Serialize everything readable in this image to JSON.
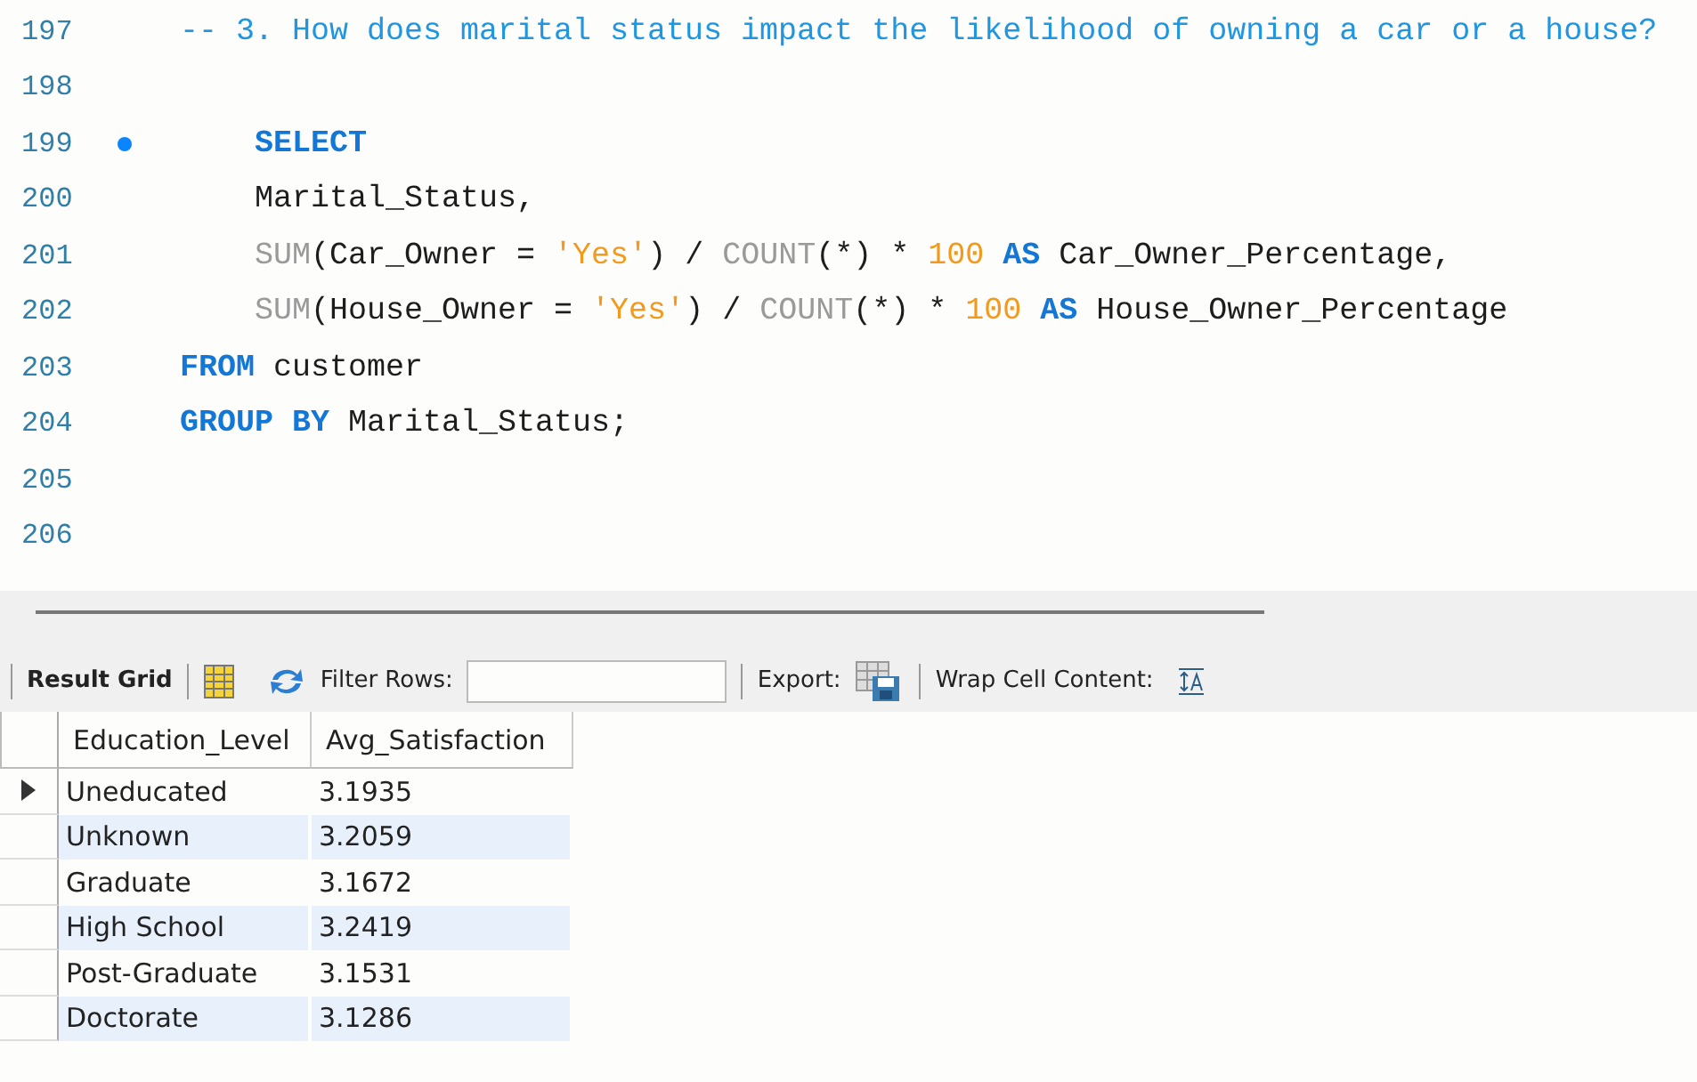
{
  "editor": {
    "lines": [
      {
        "number": "197",
        "breakpoint": false,
        "tokens": [
          {
            "kind": "comment",
            "text": "-- 3. How does marital status impact the likelihood of owning a car or a house?"
          }
        ]
      },
      {
        "number": "198",
        "breakpoint": false
      },
      {
        "number": "199",
        "breakpoint": true,
        "tokens": [
          {
            "kind": "keyword",
            "text": "    SELECT"
          }
        ]
      },
      {
        "number": "200",
        "breakpoint": false,
        "tokens": [
          {
            "kind": "plain",
            "text": "    Marital_Status,"
          }
        ]
      },
      {
        "number": "201",
        "breakpoint": false,
        "tokens": [
          {
            "kind": "function",
            "text": "    SUM"
          },
          {
            "kind": "plain",
            "text": "(Car_Owner = "
          },
          {
            "kind": "string",
            "text": "'Yes'"
          },
          {
            "kind": "plain",
            "text": ") / "
          },
          {
            "kind": "function",
            "text": "COUNT"
          },
          {
            "kind": "plain",
            "text": "(*) * "
          },
          {
            "kind": "number",
            "text": "100"
          },
          {
            "kind": "keyword",
            "text": "AS"
          },
          {
            "kind": "plain",
            "text": " Car_Owner_Percentage,"
          }
        ]
      },
      {
        "number": "202",
        "breakpoint": false,
        "tokens": [
          {
            "kind": "function",
            "text": "    SUM"
          },
          {
            "kind": "plain",
            "text": "(House_Owner = "
          },
          {
            "kind": "string",
            "text": "'Yes'"
          },
          {
            "kind": "plain",
            "text": ") / "
          },
          {
            "kind": "function",
            "text": "COUNT"
          },
          {
            "kind": "plain",
            "text": "(*) * "
          },
          {
            "kind": "number",
            "text": "100"
          },
          {
            "kind": "keyword",
            "text": "AS"
          },
          {
            "kind": "plain",
            "text": " House_Owner_Percentage"
          }
        ]
      },
      {
        "number": "203",
        "breakpoint": false,
        "tokens": [
          {
            "kind": "keyword",
            "text": "FROM"
          },
          {
            "kind": "plain",
            "text": " customer"
          }
        ]
      },
      {
        "number": "204",
        "breakpoint": false,
        "tokens": [
          {
            "kind": "keyword",
            "text": "GROUP BY"
          },
          {
            "kind": "plain",
            "text": " Marital_Status;"
          }
        ]
      },
      {
        "number": "205",
        "breakpoint": false
      },
      {
        "number": "206",
        "breakpoint": false
      }
    ]
  },
  "toolbar": {
    "result_grid_label": "Result Grid",
    "filter_label": "Filter Rows:",
    "export_label": "Export:",
    "wrap_label": "Wrap Cell Content:"
  },
  "grid": {
    "columns": [
      "Education_Level",
      "Avg_Satisfaction"
    ],
    "rows": [
      {
        "selected": true,
        "cells": [
          "Uneducated",
          "3.1935"
        ]
      },
      {
        "selected": false,
        "cells": [
          "Unknown",
          "3.2059"
        ]
      },
      {
        "selected": false,
        "cells": [
          "Graduate",
          "3.1672"
        ]
      },
      {
        "selected": false,
        "cells": [
          "High School",
          "3.2419"
        ]
      },
      {
        "selected": false,
        "cells": [
          "Post-Graduate",
          "3.1531"
        ]
      },
      {
        "selected": false,
        "cells": [
          "Doctorate",
          "3.1286"
        ]
      }
    ]
  }
}
